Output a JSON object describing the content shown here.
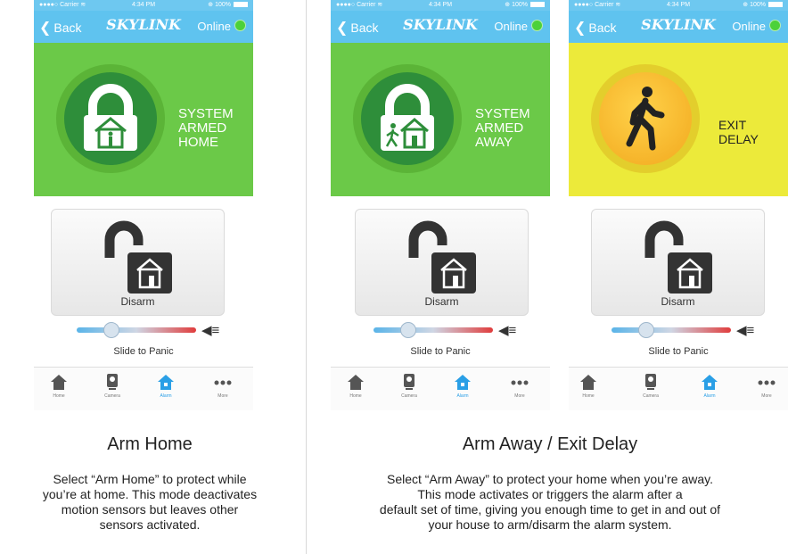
{
  "colors": {
    "nav_blue": "#5fc3ef",
    "armed_green": "#6bc948",
    "exit_yellow": "#ecea3a",
    "active_tab": "#2a9fe6"
  },
  "phones": [
    {
      "status_bar": {
        "carrier": "●●●●○ Carrier ≋",
        "time": "4:34 PM",
        "battery": "⊕ 100%"
      },
      "nav": {
        "back": "Back",
        "logo": "SKYLINK",
        "online": "Online"
      },
      "status": {
        "line1": "SYSTEM",
        "line2": "ARMED",
        "line3": "HOME",
        "icon": "padlock-home-icon"
      },
      "disarm_label": "Disarm",
      "slider_label": "Slide to Panic",
      "tabs": [
        "Home",
        "Camera",
        "Alarm",
        "More"
      ]
    },
    {
      "status_bar": {
        "carrier": "●●●●○ Carrier ≋",
        "time": "4:34 PM",
        "battery": "⊕ 100%"
      },
      "nav": {
        "back": "Back",
        "logo": "SKYLINK",
        "online": "Online"
      },
      "status": {
        "line1": "SYSTEM",
        "line2": "ARMED",
        "line3": "AWAY",
        "icon": "padlock-away-icon"
      },
      "disarm_label": "Disarm",
      "slider_label": "Slide to Panic",
      "tabs": [
        "Home",
        "Camera",
        "Alarm",
        "More"
      ]
    },
    {
      "status_bar": {
        "carrier": "●●●●○ Carrier ≋",
        "time": "4:34 PM",
        "battery": "⊕ 100%"
      },
      "nav": {
        "back": "Back",
        "logo": "SKYLINK",
        "online": "Online"
      },
      "status": {
        "line1": "EXIT",
        "line2": "DELAY",
        "line3": "",
        "icon": "walking-person-icon"
      },
      "disarm_label": "Disarm",
      "slider_label": "Slide to Panic",
      "tabs": [
        "Home",
        "Camera",
        "Alarm",
        "More"
      ]
    }
  ],
  "captions": {
    "left": {
      "title": "Arm Home",
      "lines": [
        "Select “Arm Home” to protect while",
        "you’re at home. This mode deactivates",
        "motion sensors but leaves other",
        "sensors activated."
      ]
    },
    "right": {
      "title": "Arm Away / Exit Delay",
      "lines": [
        "Select “Arm Away” to protect your home when you’re away.",
        "This mode activates or triggers the alarm after a",
        "default set of time, giving you enough time to get in and out of",
        "your house to arm/disarm the alarm system."
      ]
    }
  }
}
